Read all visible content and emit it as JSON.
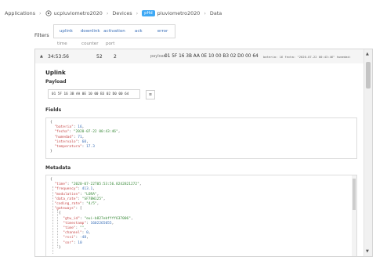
{
  "breadcrumb": {
    "applications": "Applications",
    "app": "ucpluviometro2020",
    "devices": "Devices",
    "device_badge": "pHd",
    "device": "pluviometro2020",
    "data": "Data"
  },
  "filters": {
    "label": "Filters",
    "tabs": [
      "uplink",
      "downlink",
      "activation",
      "ack",
      "error"
    ]
  },
  "columns": {
    "time": "time",
    "counter": "counter",
    "port": "port"
  },
  "message": {
    "time": "34:53:56",
    "counter": "52",
    "port": "2",
    "payload_label": "payload:",
    "payload_hex": "01 5F 16 3B AA 0E 10 00 B3 02 D0 00 64",
    "extra": "bateria: 16  fecha: \"2020-07-22 00:43:46\"  humedad:"
  },
  "detail": {
    "heading": "Uplink",
    "payload_heading": "Payload",
    "payload_box": "01 5F 16 3B AA 0E 10 00 B3 02 D0 00 64",
    "format_button": "≡",
    "fields_heading": "Fields",
    "metadata_heading": "Metadata"
  },
  "fields": [
    {
      "k": "bateria",
      "v": "16",
      "t": "n"
    },
    {
      "k": "fecha",
      "v": "\"2020-07-22 00:43:46\"",
      "t": "s"
    },
    {
      "k": "humedad",
      "v": "71",
      "t": "n"
    },
    {
      "k": "intervalo",
      "v": "60",
      "t": "n"
    },
    {
      "k": "temperatura",
      "v": "17.3",
      "t": "n"
    }
  ],
  "metadata": {
    "time": "\"2020-07-22T05:53:56.8242821272\"",
    "frequency": "413.1",
    "modulation": "\"LORA\"",
    "data_rate": "\"SF7BW125\"",
    "coding_rate": "\"4/5\"",
    "gtw_id": "\"eui-b827ebffff637006\"",
    "timestamp": "1602265055",
    "gw_time": "\"\"",
    "channel": "0",
    "rssi": "-48",
    "snr": "10"
  }
}
